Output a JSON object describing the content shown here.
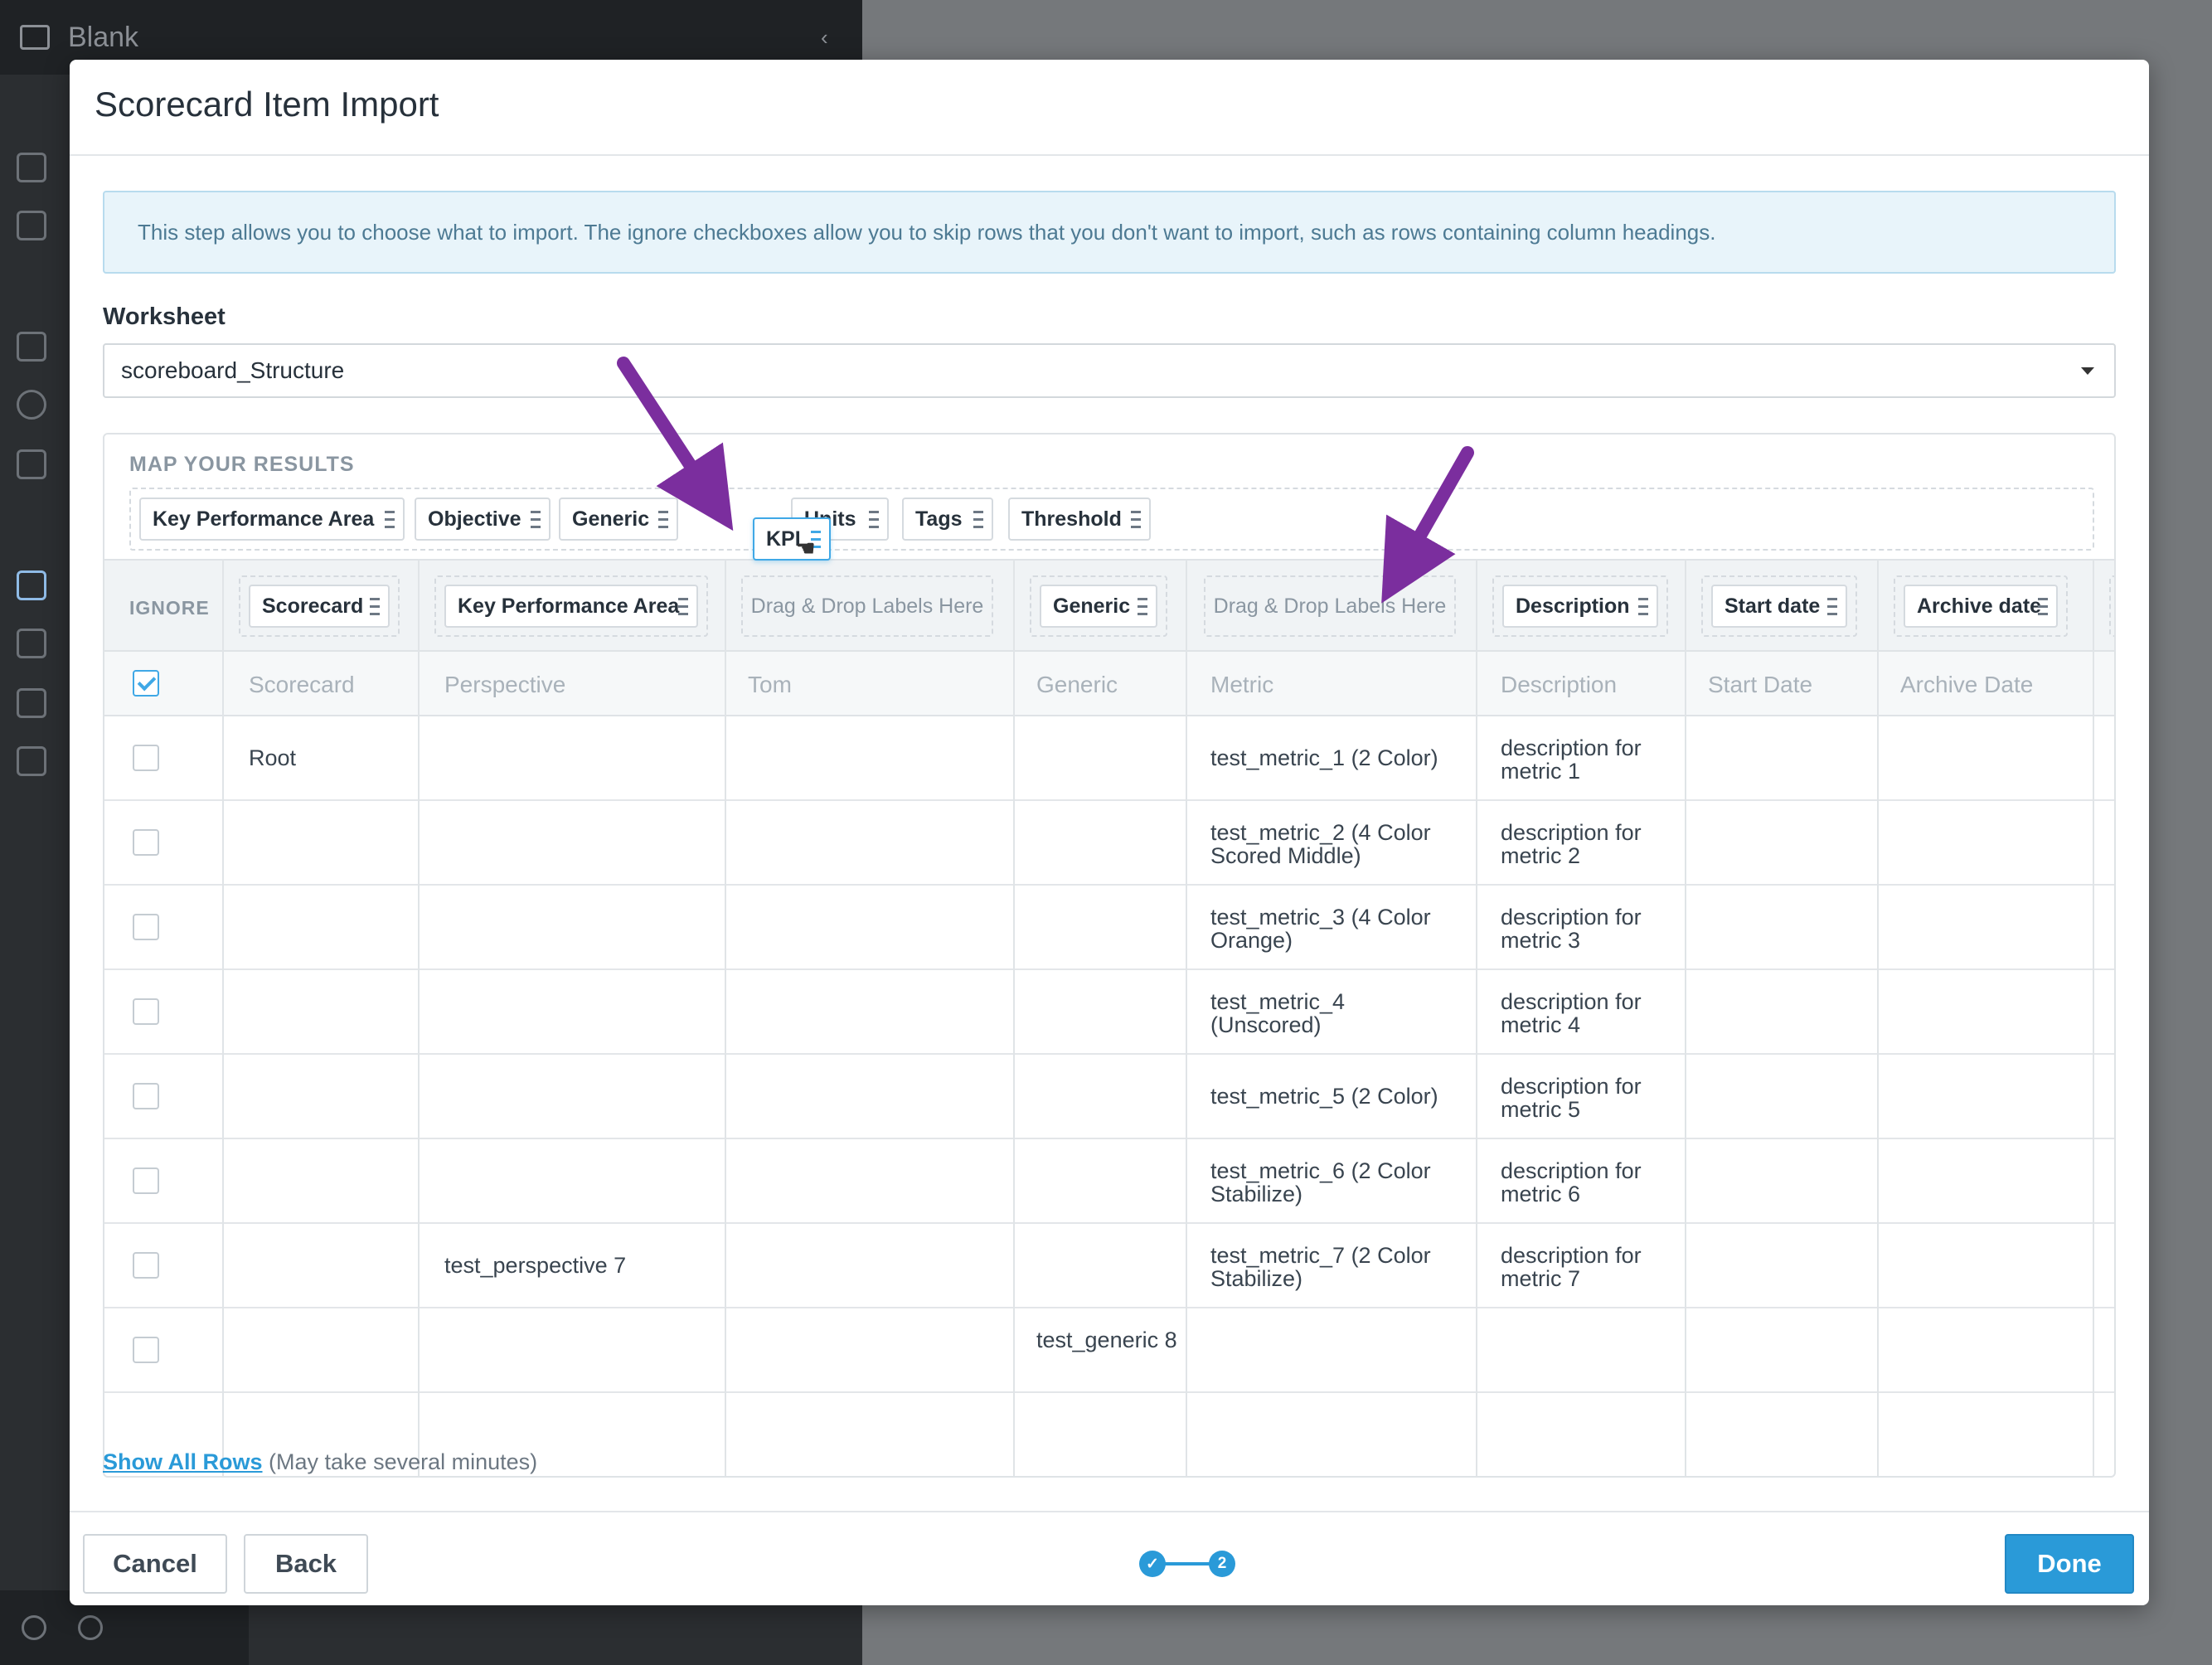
{
  "background": {
    "app_title": "Blank"
  },
  "modal": {
    "title": "Scorecard Item Import",
    "info": "This step allows you to choose what to import. The ignore checkboxes allow you to skip rows that you don't want to import, such as rows containing column headings.",
    "worksheet_label": "Worksheet",
    "worksheet_value": "scoreboard_Structure",
    "map_title": "MAP YOUR RESULTS",
    "label_pool": [
      "Key Performance Area",
      "Objective",
      "Generic",
      "Units",
      "Tags",
      "Threshold"
    ],
    "dragging_label": "KPI",
    "ignore_header": "IGNORE",
    "column_labels": [
      "Scorecard",
      "Key Performance Area",
      "Drag & Drop Labels Here",
      "Generic",
      "Drag & Drop Labels Here",
      "Description",
      "Start date",
      "Archive date"
    ],
    "source_headers": [
      "Scorecard",
      "Perspective",
      "Tom",
      "Generic",
      "Metric",
      "Description",
      "Start Date",
      "Archive Date"
    ],
    "rows": [
      {
        "scorecard": "Root",
        "perspective": "",
        "tom": "",
        "generic": "",
        "metric": "test_metric_1 (2 Color)",
        "description": "description for metric 1"
      },
      {
        "scorecard": "",
        "perspective": "",
        "tom": "",
        "generic": "",
        "metric": "test_metric_2 (4 Color Scored Middle)",
        "description": "description for metric 2"
      },
      {
        "scorecard": "",
        "perspective": "",
        "tom": "",
        "generic": "",
        "metric": "test_metric_3 (4 Color Orange)",
        "description": "description for metric 3"
      },
      {
        "scorecard": "",
        "perspective": "",
        "tom": "",
        "generic": "",
        "metric": "test_metric_4 (Unscored)",
        "description": "description for metric 4"
      },
      {
        "scorecard": "",
        "perspective": "",
        "tom": "",
        "generic": "",
        "metric": "test_metric_5 (2 Color)",
        "description": "description for metric 5"
      },
      {
        "scorecard": "",
        "perspective": "",
        "tom": "",
        "generic": "",
        "metric": "test_metric_6 (2 Color Stabilize)",
        "description": "description for metric 6"
      },
      {
        "scorecard": "",
        "perspective": "test_perspective 7",
        "tom": "",
        "generic": "",
        "metric": "test_metric_7 (2 Color Stabilize)",
        "description": "description for metric 7"
      },
      {
        "scorecard": "",
        "perspective": "",
        "tom": "",
        "generic": "test_generic 8",
        "metric": "",
        "description": ""
      }
    ],
    "show_all_link": "Show All Rows",
    "show_all_note": "(May take several minutes)",
    "cancel_label": "Cancel",
    "back_label": "Back",
    "done_label": "Done",
    "step_current": "2",
    "accent_color": "#2a9ad8",
    "arrow_color": "#7b2e9e"
  }
}
